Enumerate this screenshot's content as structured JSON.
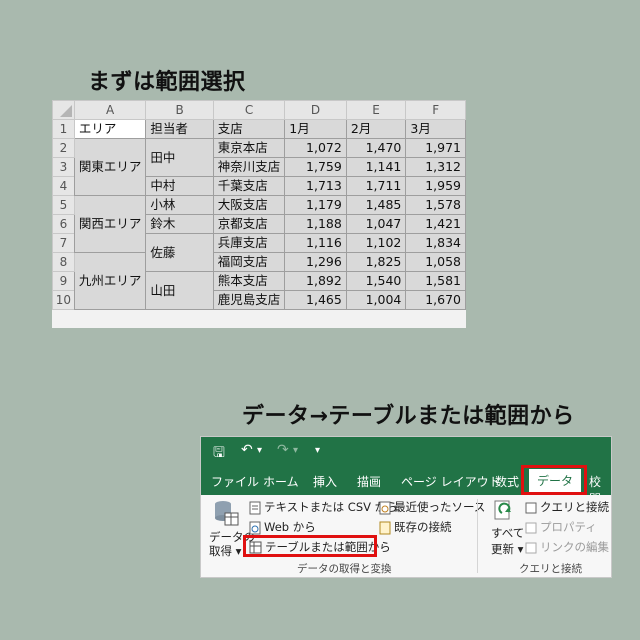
{
  "heading1": "まずは範囲選択",
  "heading2": "データ→テーブルまたは範囲から",
  "sheet": {
    "columns": [
      "A",
      "B",
      "C",
      "D",
      "E",
      "F"
    ],
    "row_numbers": [
      "1",
      "2",
      "3",
      "4",
      "5",
      "6",
      "7",
      "8",
      "9",
      "10"
    ],
    "header": [
      "エリア",
      "担当者",
      "支店",
      "1月",
      "2月",
      "3月"
    ],
    "areas": [
      "関東エリア",
      "関西エリア",
      "九州エリア"
    ],
    "people": [
      "田中",
      "中村",
      "小林",
      "鈴木",
      "佐藤",
      "山田"
    ],
    "branches": [
      "東京本店",
      "神奈川支店",
      "千葉支店",
      "大阪支店",
      "京都支店",
      "兵庫支店",
      "福岡支店",
      "熊本支店",
      "鹿児島支店"
    ],
    "values": [
      [
        "1,072",
        "1,470",
        "1,971"
      ],
      [
        "1,759",
        "1,141",
        "1,312"
      ],
      [
        "1,713",
        "1,711",
        "1,959"
      ],
      [
        "1,179",
        "1,485",
        "1,578"
      ],
      [
        "1,188",
        "1,047",
        "1,421"
      ],
      [
        "1,116",
        "1,102",
        "1,834"
      ],
      [
        "1,296",
        "1,825",
        "1,058"
      ],
      [
        "1,892",
        "1,540",
        "1,581"
      ],
      [
        "1,465",
        "1,004",
        "1,670"
      ]
    ]
  },
  "ribbon": {
    "qat": {
      "save": "🖫",
      "undo": "↶",
      "undo_dd": "▾",
      "redo": "↷",
      "redo_dd": "▾",
      "customize": "▾"
    },
    "tabs": [
      "ファイル",
      "ホーム",
      "挿入",
      "描画",
      "ページ レイアウト",
      "数式",
      "データ",
      "校閲"
    ],
    "group1": {
      "get_data": "データの",
      "get_data2": "取得 ▾",
      "text_csv": "テキストまたは CSV から",
      "web": "Web から",
      "table_range": "テーブルまたは範囲から",
      "recent": "最近使ったソース",
      "existing": "既存の接続",
      "label": "データの取得と変換"
    },
    "group2": {
      "refresh1": "すべて",
      "refresh2": "更新 ▾",
      "queries": "クエリと接続",
      "properties": "プロパティ",
      "edit_links": "リンクの編集",
      "label": "クエリと接続"
    },
    "colors": {
      "accent": "#217346",
      "highlight": "#e01010"
    }
  }
}
